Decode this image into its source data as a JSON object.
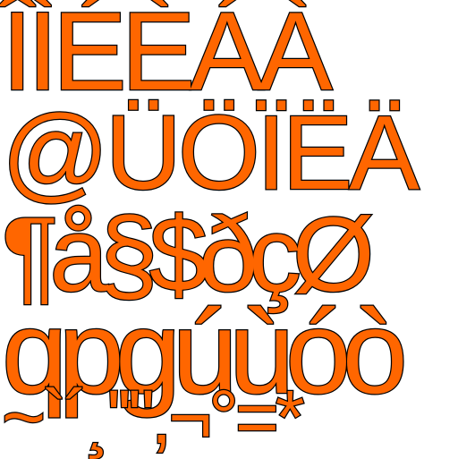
{
  "glyph_sheet": {
    "fill_color": "#ff6600",
    "outline_color": "#000000",
    "background_color": "#ffffff",
    "rows": [
      "ÎÌÉÈÁÀ",
      "@ÜÖÏËÄ",
      "¶å§$ðçØ",
      "qpgúùóò",
      "~`´¸''\",¬°=*"
    ]
  }
}
